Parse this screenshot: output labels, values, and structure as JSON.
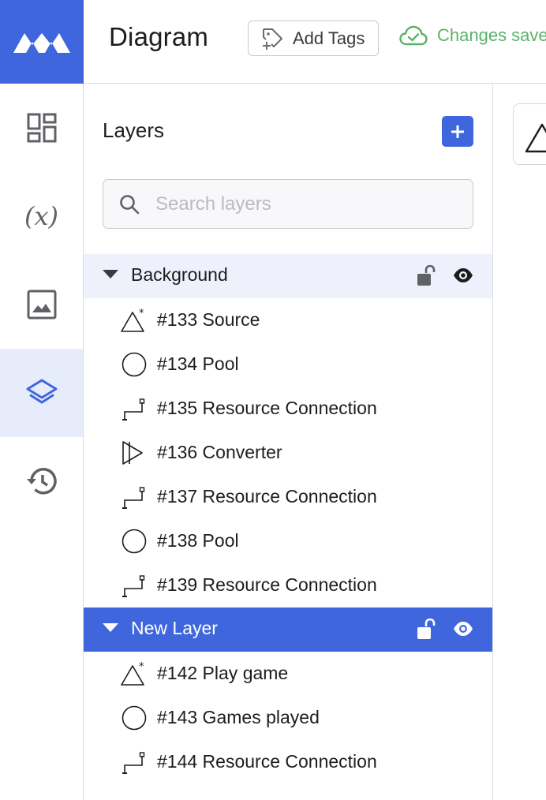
{
  "app": {
    "title": "Diagram",
    "add_tags_label": "Add Tags",
    "save_status": "Changes saved",
    "accent": "#3f66dc",
    "success": "#5bb26a"
  },
  "nav": {
    "items": [
      {
        "name": "dashboard-icon",
        "active": false
      },
      {
        "name": "variables-icon",
        "active": false
      },
      {
        "name": "image-icon",
        "active": false
      },
      {
        "name": "layers-icon",
        "active": true
      },
      {
        "name": "history-icon",
        "active": false
      }
    ]
  },
  "layers_panel": {
    "title": "Layers",
    "add_icon": "plus-icon",
    "search_placeholder": "Search layers",
    "layers": [
      {
        "name": "Background",
        "selected": false,
        "items": [
          {
            "id_label": "#133 Source",
            "icon": "source-icon"
          },
          {
            "id_label": "#134 Pool",
            "icon": "pool-icon"
          },
          {
            "id_label": "#135 Resource Connection",
            "icon": "connection-icon"
          },
          {
            "id_label": "#136 Converter",
            "icon": "converter-icon"
          },
          {
            "id_label": "#137 Resource Connection",
            "icon": "connection-icon"
          },
          {
            "id_label": "#138 Pool",
            "icon": "pool-icon"
          },
          {
            "id_label": "#139 Resource Connection",
            "icon": "connection-icon"
          }
        ]
      },
      {
        "name": "New Layer",
        "selected": true,
        "items": [
          {
            "id_label": "#142 Play game",
            "icon": "source-icon"
          },
          {
            "id_label": "#143 Games played",
            "icon": "pool-icon"
          },
          {
            "id_label": "#144 Resource Connection",
            "icon": "connection-icon"
          }
        ]
      }
    ]
  }
}
